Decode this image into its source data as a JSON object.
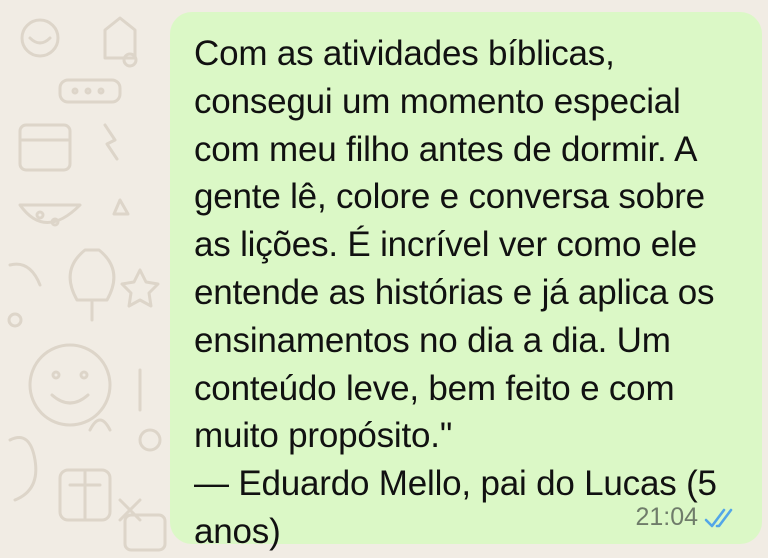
{
  "chat": {
    "message": {
      "lines": [
        "Com as atividades bíblicas,",
        "consegui um momento especial",
        "com meu filho antes de dormir. A",
        "gente lê, colore e conversa sobre",
        "as lições. É incrível ver como ele",
        "entende as histórias e já aplica os",
        "ensinamentos no dia a dia. Um",
        "conteúdo leve, bem feito e com",
        "muito propósito.\"",
        "— Eduardo Mello, pai do Lucas (5",
        "anos)"
      ],
      "time": "21:04",
      "status_icon": "double-check-read-icon"
    }
  },
  "colors": {
    "wallpaper": "#f1ece4",
    "bubble": "#dbf8c6",
    "read_ticks": "#53a6e8",
    "timestamp": "#6f7c6a"
  }
}
